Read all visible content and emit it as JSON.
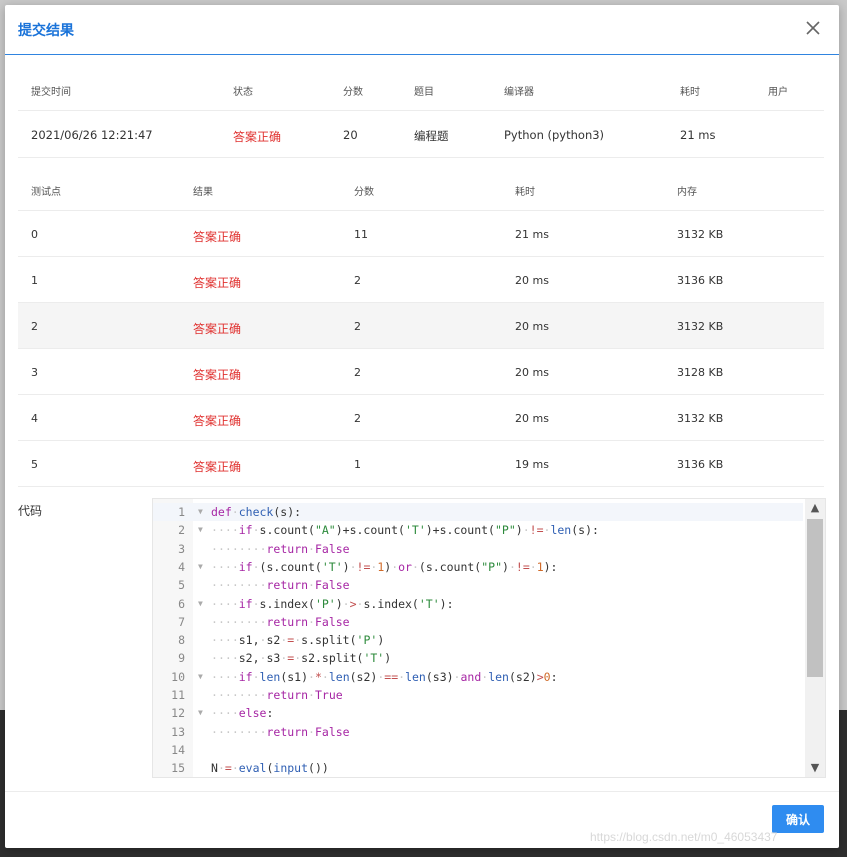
{
  "modal": {
    "title": "提交结果",
    "ok_label": "确认"
  },
  "summary": {
    "headers": [
      "提交时间",
      "状态",
      "分数",
      "题目",
      "编译器",
      "耗时",
      "用户"
    ],
    "row": [
      "2021/06/26 12:21:47",
      "答案正确",
      "20",
      "编程题",
      "Python (python3)",
      "21 ms",
      ""
    ]
  },
  "tests": {
    "headers": [
      "测试点",
      "结果",
      "分数",
      "耗时",
      "内存"
    ],
    "rows": [
      [
        "0",
        "答案正确",
        "11",
        "21 ms",
        "3132 KB"
      ],
      [
        "1",
        "答案正确",
        "2",
        "20 ms",
        "3136 KB"
      ],
      [
        "2",
        "答案正确",
        "2",
        "20 ms",
        "3132 KB"
      ],
      [
        "3",
        "答案正确",
        "2",
        "20 ms",
        "3128 KB"
      ],
      [
        "4",
        "答案正确",
        "2",
        "20 ms",
        "3132 KB"
      ],
      [
        "5",
        "答案正确",
        "1",
        "19 ms",
        "3136 KB"
      ]
    ]
  },
  "code": {
    "label": "代码",
    "lines": [
      {
        "n": "1",
        "text": "def check(s):"
      },
      {
        "n": "2",
        "text": "    if s.count(\"A\")+s.count('T')+s.count(\"P\") != len(s):"
      },
      {
        "n": "3",
        "text": "        return False"
      },
      {
        "n": "4",
        "text": "    if (s.count('T') != 1) or (s.count(\"P\") != 1):"
      },
      {
        "n": "5",
        "text": "        return False"
      },
      {
        "n": "6",
        "text": "    if s.index('P') > s.index('T'):"
      },
      {
        "n": "7",
        "text": "        return False"
      },
      {
        "n": "8",
        "text": "    s1, s2 = s.split('P')"
      },
      {
        "n": "9",
        "text": "    s2, s3 = s2.split('T')"
      },
      {
        "n": "10",
        "text": "    if len(s1) * len(s2) == len(s3) and len(s2)>0:"
      },
      {
        "n": "11",
        "text": "        return True"
      },
      {
        "n": "12",
        "text": "    else:"
      },
      {
        "n": "13",
        "text": "        return False"
      },
      {
        "n": "14",
        "text": ""
      },
      {
        "n": "15",
        "text": "N = eval(input())"
      }
    ]
  },
  "watermark": "https://blog.csdn.net/m0_46053437",
  "colors": {
    "accent": "#2f8cf0",
    "correct": "#e0312f"
  },
  "icons": {
    "close": "close-icon",
    "scroll_up": "chevron-up-icon",
    "scroll_down": "chevron-down-icon"
  }
}
